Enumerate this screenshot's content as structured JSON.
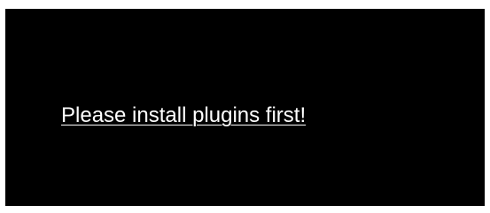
{
  "window": {
    "background_color": "#000000",
    "border_color": "#ffffff"
  },
  "message": {
    "text": "Please install plugins first!",
    "color": "#ffffff"
  }
}
